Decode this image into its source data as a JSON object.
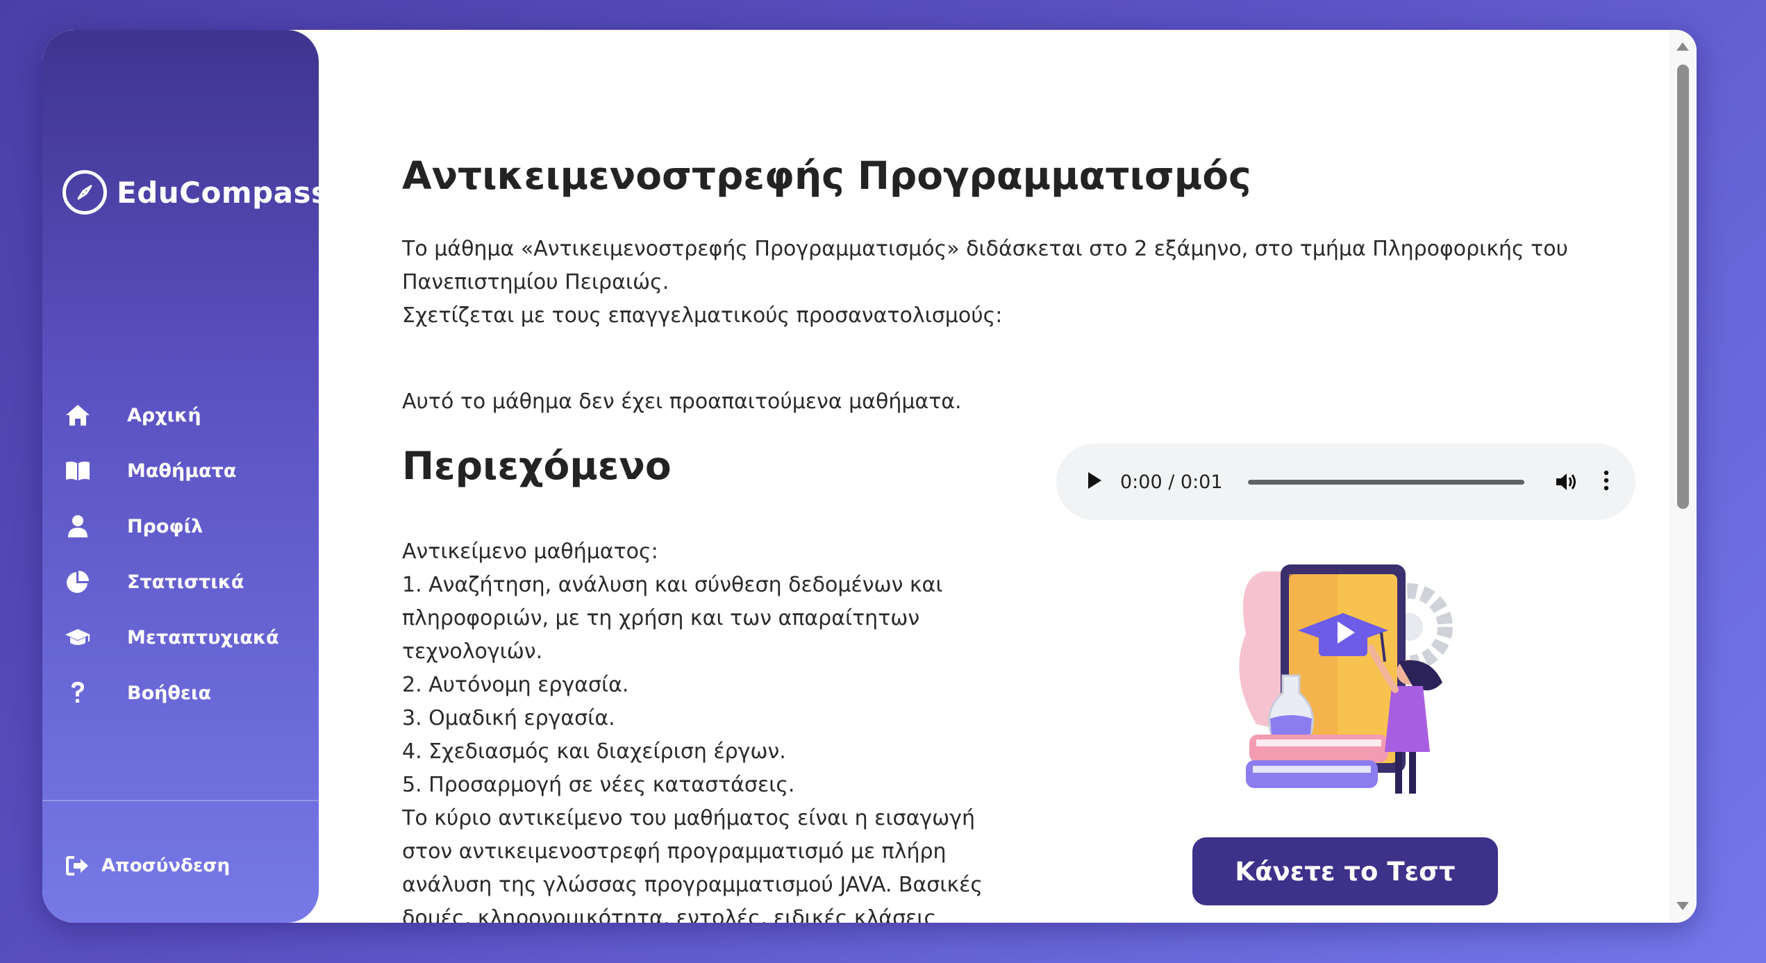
{
  "app": {
    "name": "EduCompass"
  },
  "sidebar": {
    "items": [
      {
        "label": "Αρχική",
        "icon": "home-icon"
      },
      {
        "label": "Μαθήματα",
        "icon": "book-icon"
      },
      {
        "label": "Προφίλ",
        "icon": "user-icon"
      },
      {
        "label": "Στατιστικά",
        "icon": "pie-chart-icon"
      },
      {
        "label": "Μεταπτυχιακά",
        "icon": "graduation-cap-icon"
      },
      {
        "label": "Βοήθεια",
        "icon": "question-icon"
      }
    ],
    "logout": {
      "label": "Αποσύνδεση",
      "icon": "sign-out-icon"
    }
  },
  "course": {
    "title": "Αντικειμενοστρεφής Προγραμματισμός",
    "description_lines": [
      "Το μάθημα «Αντικειμενοστρεφής Προγραμματισμός» διδάσκεται στο 2 εξάμηνο, στο τμήμα Πληροφορικής του",
      "Πανεπιστημίου Πειραιώς.",
      "Σχετίζεται με τους επαγγελματικούς προσανατολισμούς:"
    ],
    "prerequisites": "Αυτό το μάθημα δεν έχει προαπαιτούμενα μαθήματα.",
    "content_heading": "Περιεχόμενο",
    "content_lines": [
      "Αντικείμενο μαθήματος:",
      "1. Αναζήτηση, ανάλυση και σύνθεση δεδομένων και",
      "πληροφοριών, με τη χρήση και των απαραίτητων",
      "τεχνολογιών.",
      "2. Αυτόνομη εργασία.",
      "3. Ομαδική εργασία.",
      "4. Σχεδιασμός και διαχείριση έργων.",
      "5. Προσαρμογή σε νέες καταστάσεις.",
      "Το κύριο αντικείμενο του μαθήματος είναι η εισαγωγή",
      "στον αντικειμενοστρεφή προγραμματισμό με πλήρη",
      "ανάλυση της γλώσσας προγραμματισμού JAVA. Βασικές",
      "δομές, κληρονομικότητα, εντολές, ειδικές κλάσεις"
    ]
  },
  "audio": {
    "time": "0:00 / 0:01"
  },
  "test_button": {
    "label": "Κάνετε το Τεστ"
  },
  "colors": {
    "accent": "#3d318a",
    "sidebar_top": "#3f348f",
    "sidebar_bottom": "#7679e6"
  }
}
